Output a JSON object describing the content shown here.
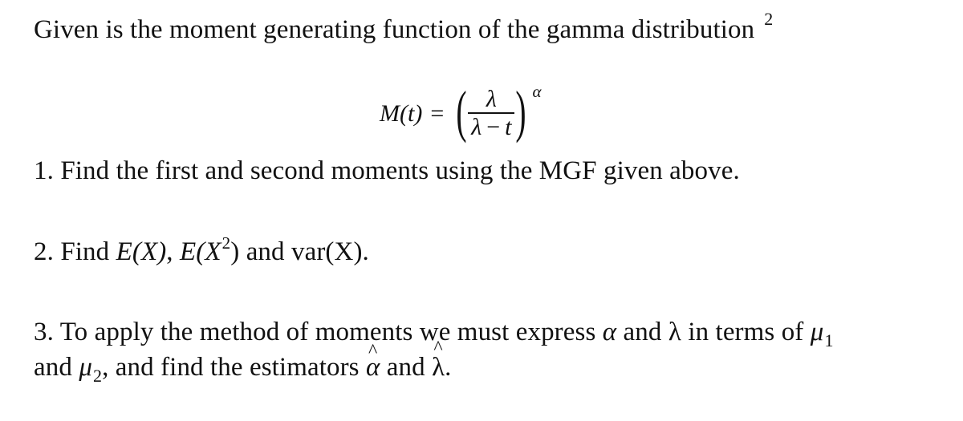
{
  "intro": {
    "text": "Given is the moment generating function of the gamma distribution",
    "footnote_mark": "2"
  },
  "formula": {
    "lhs": "M(t)",
    "equals": "=",
    "numerator": "λ",
    "denominator_left": "λ",
    "denominator_op": "−",
    "denominator_right": "t",
    "exponent": "α",
    "paren_open": "(",
    "paren_close": ")"
  },
  "items": [
    {
      "number": "1.",
      "text": "Find the first and second moments using the MGF given above."
    },
    {
      "number": "2.",
      "prefix": "Find",
      "ex": "E(X)",
      "comma": ",",
      "ex2_base": "E(X",
      "ex2_sup": "2",
      "ex2_close": ")",
      "and": "and",
      "var": "var(X)."
    },
    {
      "number": "3.",
      "line1_a": "To apply the method of moments we must express",
      "alpha": "α",
      "and1": "and",
      "lambda": "λ",
      "line1_b": "in terms of",
      "mu": "μ",
      "mu1_sub": "1",
      "line2_a": "and",
      "mu2_sub": "2",
      "line2_b": ", and find the estimators",
      "alpha_hat": "α",
      "and2": "and",
      "lambda_hat": "λ",
      "end": "."
    }
  ]
}
